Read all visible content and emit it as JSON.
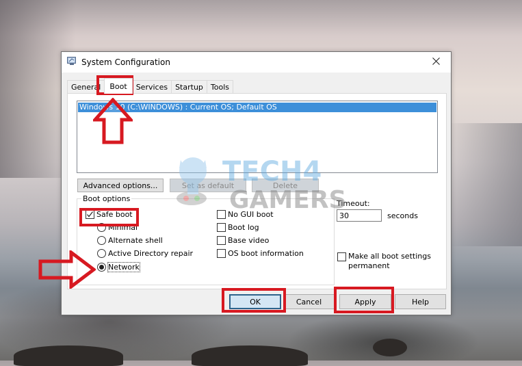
{
  "window": {
    "title": "System Configuration",
    "icon": "msconfig-icon",
    "close_icon": "close-icon"
  },
  "tabs": [
    {
      "label": "General",
      "active": false
    },
    {
      "label": "Boot",
      "active": true
    },
    {
      "label": "Services",
      "active": false
    },
    {
      "label": "Startup",
      "active": false
    },
    {
      "label": "Tools",
      "active": false
    }
  ],
  "os_list": {
    "items": [
      {
        "label": "Windows 10 (C:\\WINDOWS) : Current OS; Default OS",
        "selected": true
      }
    ]
  },
  "list_buttons": {
    "advanced": "Advanced options...",
    "set_default": "Set as default",
    "delete": "Delete"
  },
  "boot_options": {
    "legend": "Boot options",
    "safe_boot": {
      "label": "Safe boot",
      "checked": true
    },
    "safe_modes": [
      {
        "label": "Minimal",
        "selected": false
      },
      {
        "label": "Alternate shell",
        "selected": false
      },
      {
        "label": "Active Directory repair",
        "selected": false
      },
      {
        "label": "Network",
        "selected": true
      }
    ],
    "flags": [
      {
        "label": "No GUI boot",
        "checked": false
      },
      {
        "label": "Boot log",
        "checked": false
      },
      {
        "label": "Base video",
        "checked": false
      },
      {
        "label": "OS boot information",
        "checked": false
      }
    ]
  },
  "timeout": {
    "label": "Timeout:",
    "value": "30",
    "unit": "seconds"
  },
  "permanent": {
    "label_line1": "Make all boot settings",
    "label_line2": "permanent",
    "checked": false
  },
  "footer_buttons": {
    "ok": "OK",
    "cancel": "Cancel",
    "apply": "Apply",
    "help": "Help"
  },
  "annotations": {
    "highlight_color": "#d71921",
    "watermark_line1": "TECH4",
    "watermark_line2": "GAMERS"
  }
}
